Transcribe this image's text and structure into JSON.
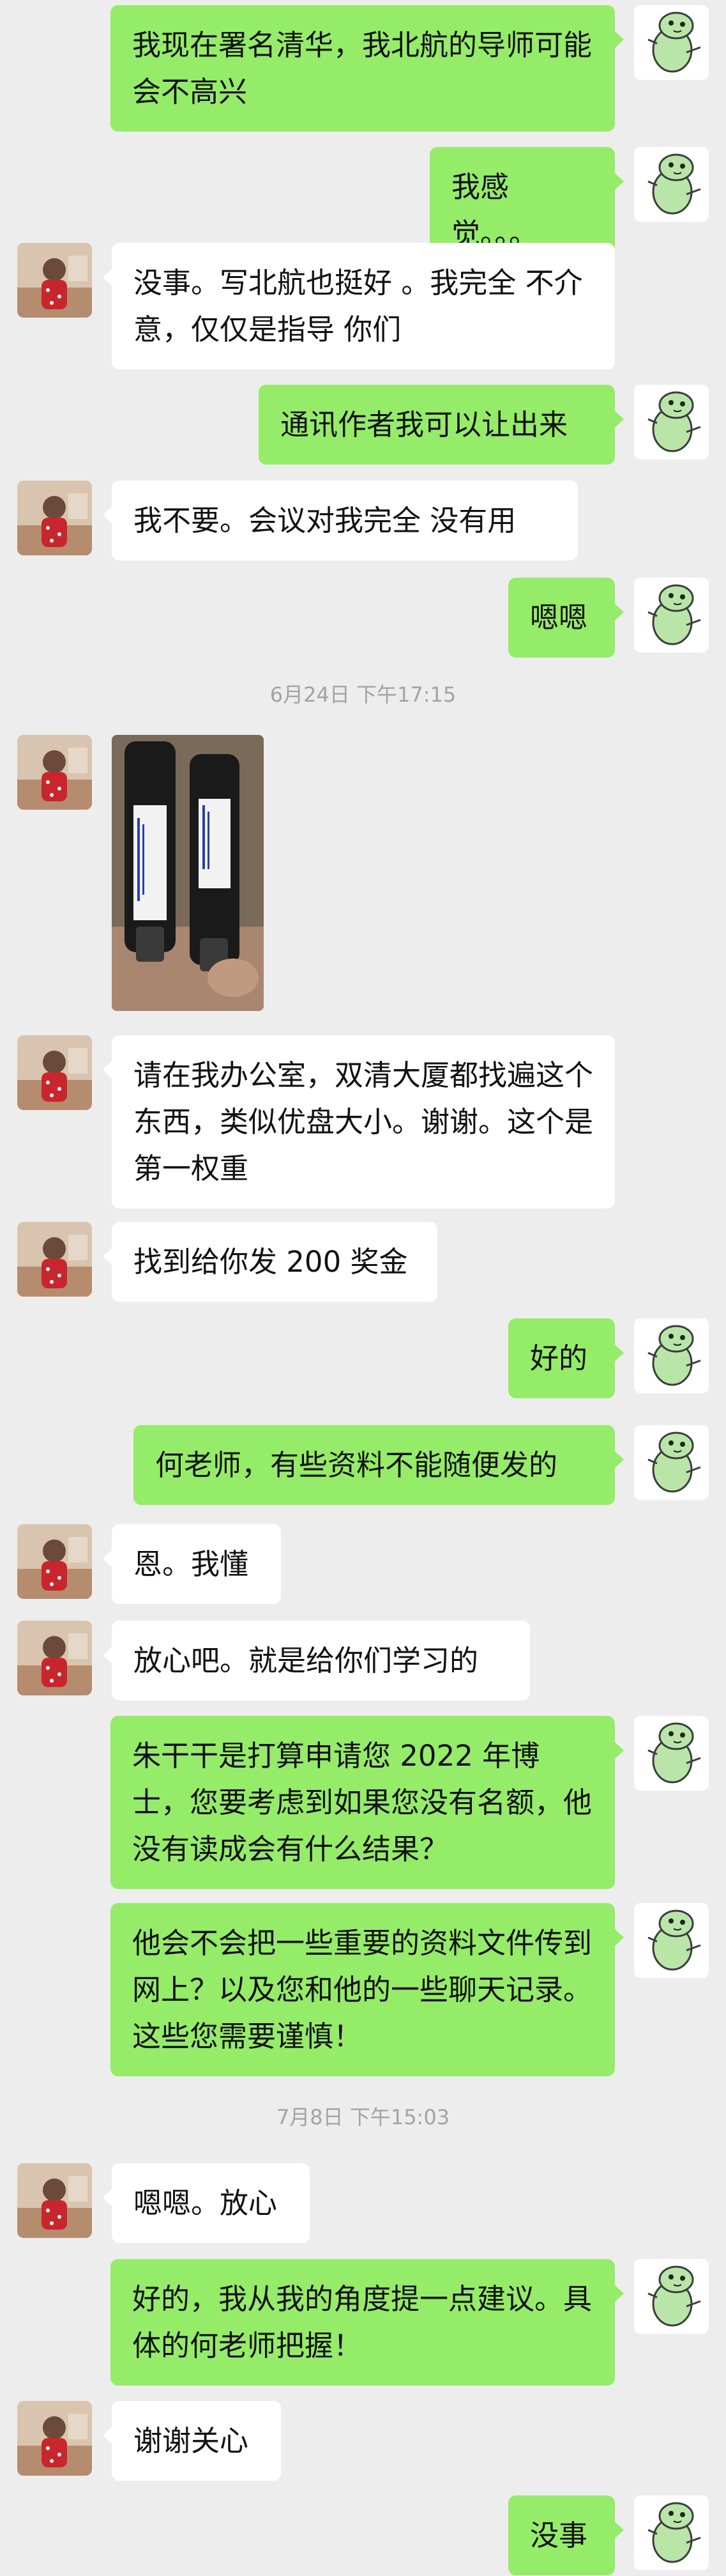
{
  "messages": [
    {
      "from": "me",
      "text": "我现在署名清华，我北航的导师可能会不高兴"
    },
    {
      "from": "me",
      "text": "我感觉。。。"
    },
    {
      "from": "other",
      "text": "没事。写北航也挺好 。我完全 不介意，仅仅是指导 你们"
    },
    {
      "from": "me",
      "text": "通讯作者我可以让出来"
    },
    {
      "from": "other",
      "text": "我不要。会议对我完全 没有用"
    },
    {
      "from": "me",
      "text": "嗯嗯"
    },
    {
      "from": "other",
      "text": "请在我办公室，双清大厦都找遍这个东西，类似优盘大小。谢谢。这个是第一权重"
    },
    {
      "from": "other",
      "text": "找到给你发 200 奖金"
    },
    {
      "from": "me",
      "text": "好的"
    },
    {
      "from": "me",
      "text": "何老师，有些资料不能随便发的"
    },
    {
      "from": "other",
      "text": "恩。我懂"
    },
    {
      "from": "other",
      "text": "放心吧。就是给你们学习的"
    },
    {
      "from": "me",
      "text": "朱干干是打算申请您 2022 年博士，您要考虑到如果您没有名额，他没有读成会有什么结果？"
    },
    {
      "from": "me",
      "text": "他会不会把一些重要的资料文件传到网上？以及您和他的一些聊天记录。这些您需要谨慎！"
    },
    {
      "from": "other",
      "text": "嗯嗯。放心"
    },
    {
      "from": "me",
      "text": "好的，我从我的角度提一点建议。具体的何老师把握！"
    },
    {
      "from": "other",
      "text": "谢谢关心"
    },
    {
      "from": "me",
      "text": "没事"
    }
  ],
  "timestamps": [
    "6月24日 下午17:15",
    "7月8日 下午15:03"
  ],
  "icons": {
    "other_avatar": "user-avatar-photo",
    "my_avatar": "green-dinosaur-avatar",
    "photo": "usb-drive-photo"
  },
  "colors": {
    "background": "#ededed",
    "my_bubble": "#95ec69",
    "other_bubble": "#ffffff",
    "timestamp": "#a3a3a3"
  }
}
